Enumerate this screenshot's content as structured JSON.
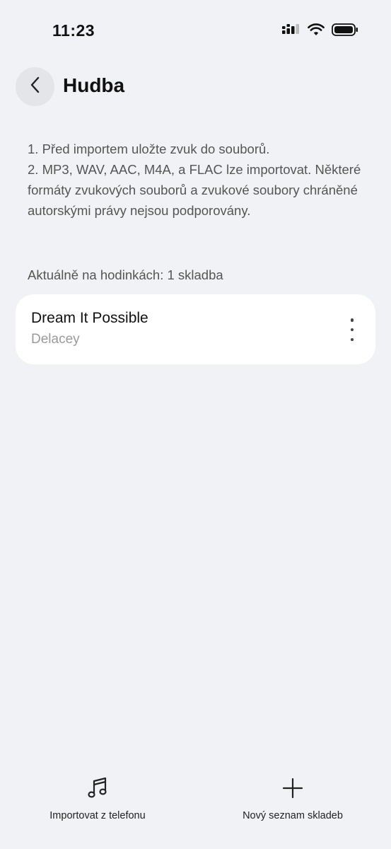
{
  "status_bar": {
    "time": "11:23",
    "icons": [
      "signal-icon",
      "wifi-icon",
      "battery-icon"
    ]
  },
  "header": {
    "title": "Hudba",
    "back_icon": "chevron-left-icon"
  },
  "instructions": [
    "1. Před importem uložte zvuk do souborů.",
    "2. MP3, WAV, AAC, M4A, a FLAC lze importovat. Některé formáty zvukových souborů a zvukové soubory chráněné autorskými právy nejsou podporovány."
  ],
  "count_label": "Aktuálně na hodinkách: 1 skladba",
  "tracks": [
    {
      "title": "Dream It Possible",
      "artist": "Delacey"
    }
  ],
  "bottom_actions": {
    "import": {
      "label": "Importovat z telefonu",
      "icon": "music-note-icon"
    },
    "new_playlist": {
      "label": "Nový seznam skladeb",
      "icon": "plus-icon"
    }
  },
  "colors": {
    "background": "#f1f2f5",
    "card": "#ffffff",
    "secondary_text": "#555555",
    "muted_text": "#9a9a9a"
  }
}
